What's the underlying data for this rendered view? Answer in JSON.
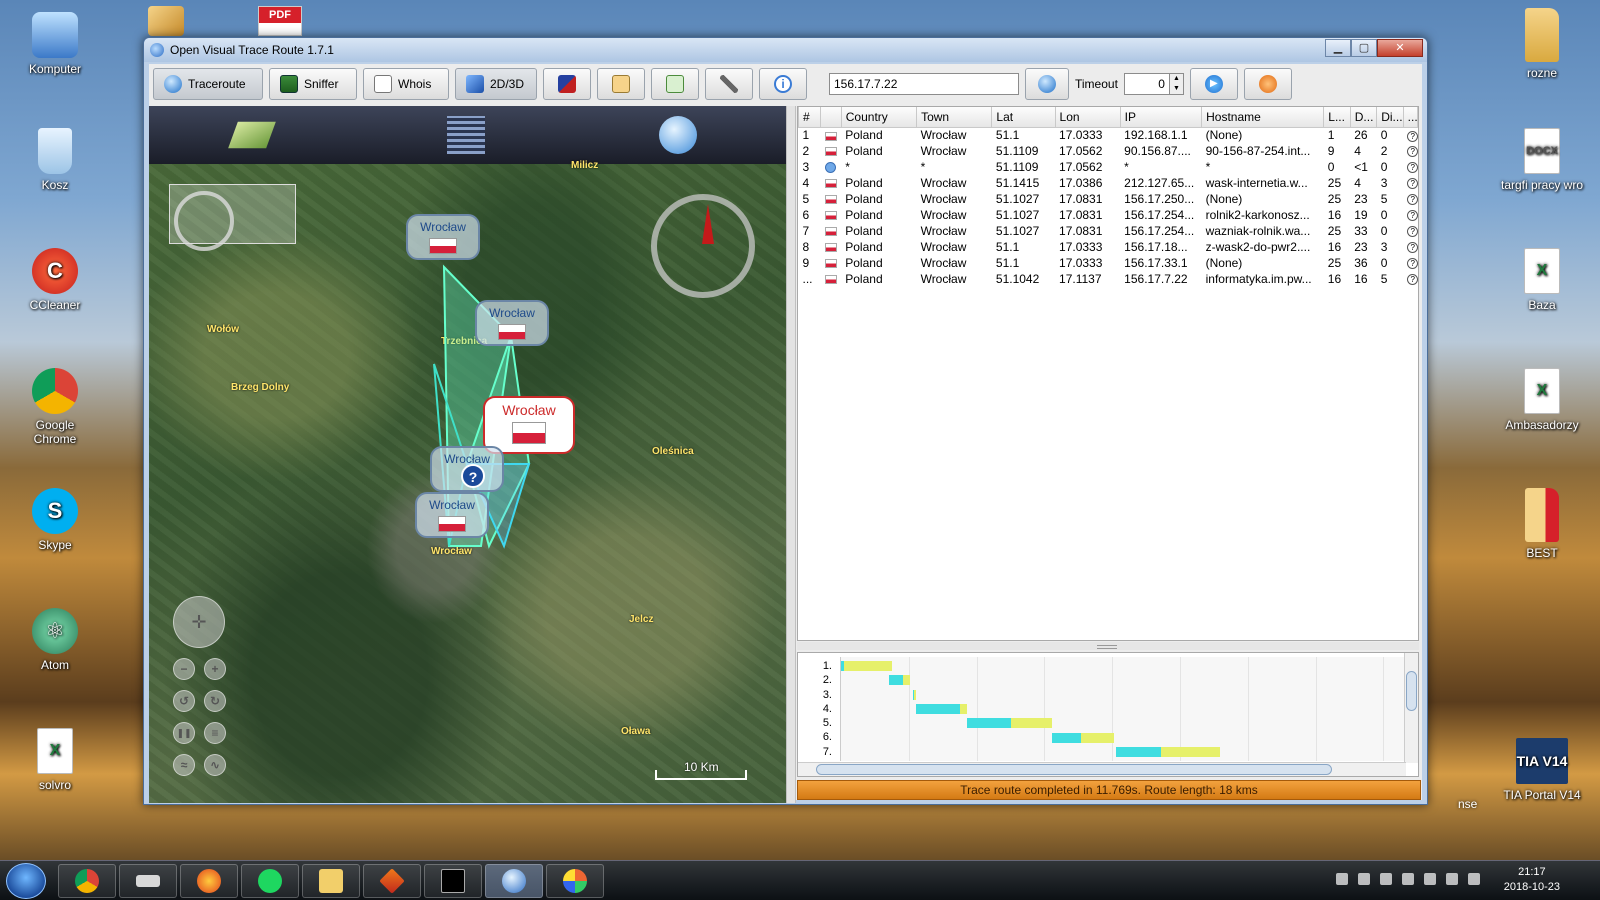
{
  "desktop": {
    "left_icons": [
      {
        "label": "Komputer",
        "icon": "computer-icon"
      },
      {
        "label": "Kosz",
        "icon": "recycle-bin-icon"
      },
      {
        "label": "CCleaner",
        "icon": "ccleaner-icon"
      },
      {
        "label": "Google Chrome",
        "icon": "chrome-icon"
      },
      {
        "label": "Skype",
        "icon": "skype-icon"
      },
      {
        "label": "Atom",
        "icon": "atom-icon"
      },
      {
        "label": "solvro",
        "icon": "excel-file-icon"
      }
    ],
    "right_icons": [
      {
        "label": "rozne",
        "icon": "folder-icon"
      },
      {
        "label": "targfi pracy wro",
        "icon": "docx-file-icon",
        "badge": "DOCX"
      },
      {
        "label": "Baza",
        "icon": "excel-file-icon"
      },
      {
        "label": "Ambasadorzy",
        "icon": "excel-file-icon"
      },
      {
        "label": "BEST",
        "icon": "pdf-folder-icon"
      },
      {
        "label": "TIA Portal V14",
        "icon": "tia-portal-icon",
        "badge": "TIA V14"
      }
    ],
    "partial_label": "nse",
    "pdf_badge": "PDF"
  },
  "window": {
    "title": "Open Visual Trace Route 1.7.1",
    "buttons": {
      "minimize": "▁",
      "maximize": "▢",
      "close": "✕"
    }
  },
  "toolbar": {
    "traceroute": "Traceroute",
    "sniffer": "Sniffer",
    "whois": "Whois",
    "view": "2D/3D",
    "target_ip": "156.17.7.22",
    "timeout_label": "Timeout",
    "timeout_value": "0",
    "info_glyph": "i"
  },
  "map": {
    "places": [
      "Milicz",
      "Wołów",
      "Trzebnica",
      "Brzeg Dolny",
      "Oleśnica",
      "Wrocław",
      "Jelcz",
      "Oława"
    ],
    "hops": [
      {
        "label": "Wrocław"
      },
      {
        "label": "Wrocław"
      },
      {
        "label": "Wrocław"
      },
      {
        "label": "Wrocław"
      },
      {
        "label": "Wrocław"
      }
    ],
    "unknown_glyph": "?",
    "scale": "10 Km",
    "accent": "#66ffcc"
  },
  "table": {
    "columns": [
      "#",
      "",
      "Country",
      "Town",
      "Lat",
      "Lon",
      "IP",
      "Hostname",
      "L...",
      "D...",
      "Di...",
      "..."
    ],
    "rows": [
      {
        "n": "1",
        "country": "Poland",
        "town": "Wrocław",
        "lat": "51.1",
        "lon": "17.0333",
        "ip": "192.168.1.1",
        "host": "(None)",
        "l": "1",
        "d": "26",
        "di": "0"
      },
      {
        "n": "2",
        "country": "Poland",
        "town": "Wrocław",
        "lat": "51.1109",
        "lon": "17.0562",
        "ip": "90.156.87....",
        "host": "90-156-87-254.int...",
        "l": "9",
        "d": "4",
        "di": "2"
      },
      {
        "n": "3",
        "country": "*",
        "town": "*",
        "lat": "51.1109",
        "lon": "17.0562",
        "ip": "*",
        "host": "*",
        "l": "0",
        "d": "<1",
        "di": "0",
        "unknown": true
      },
      {
        "n": "4",
        "country": "Poland",
        "town": "Wrocław",
        "lat": "51.1415",
        "lon": "17.0386",
        "ip": "212.127.65...",
        "host": "wask-internetia.w...",
        "l": "25",
        "d": "4",
        "di": "3"
      },
      {
        "n": "5",
        "country": "Poland",
        "town": "Wrocław",
        "lat": "51.1027",
        "lon": "17.0831",
        "ip": "156.17.250...",
        "host": "(None)",
        "l": "25",
        "d": "23",
        "di": "5"
      },
      {
        "n": "6",
        "country": "Poland",
        "town": "Wrocław",
        "lat": "51.1027",
        "lon": "17.0831",
        "ip": "156.17.254...",
        "host": "rolnik2-karkonosz...",
        "l": "16",
        "d": "19",
        "di": "0"
      },
      {
        "n": "7",
        "country": "Poland",
        "town": "Wrocław",
        "lat": "51.1027",
        "lon": "17.0831",
        "ip": "156.17.254...",
        "host": "wazniak-rolnik.wa...",
        "l": "25",
        "d": "33",
        "di": "0"
      },
      {
        "n": "8",
        "country": "Poland",
        "town": "Wrocław",
        "lat": "51.1",
        "lon": "17.0333",
        "ip": "156.17.18...",
        "host": "z-wask2-do-pwr2....",
        "l": "16",
        "d": "23",
        "di": "3"
      },
      {
        "n": "9",
        "country": "Poland",
        "town": "Wrocław",
        "lat": "51.1",
        "lon": "17.0333",
        "ip": "156.17.33.1",
        "host": "(None)",
        "l": "25",
        "d": "36",
        "di": "0"
      },
      {
        "n": "...",
        "country": "Poland",
        "town": "Wrocław",
        "lat": "51.1042",
        "lon": "17.1137",
        "ip": "156.17.7.22",
        "host": "informatyka.im.pw...",
        "l": "16",
        "d": "16",
        "di": "5"
      }
    ],
    "help_glyph": "?"
  },
  "gantt": {
    "labels": [
      "1.",
      "2.",
      "3.",
      "4.",
      "5.",
      "6.",
      "7."
    ],
    "bars": [
      {
        "start": 0.0,
        "cyan": 0.005,
        "yellow": 0.085
      },
      {
        "start": 0.085,
        "cyan": 0.025,
        "yellow": 0.012
      },
      {
        "start": 0.128,
        "cyan": 0.002,
        "yellow": 0.002
      },
      {
        "start": 0.132,
        "cyan": 0.078,
        "yellow": 0.013
      },
      {
        "start": 0.223,
        "cyan": 0.078,
        "yellow": 0.073
      },
      {
        "start": 0.374,
        "cyan": 0.05,
        "yellow": 0.06
      },
      {
        "start": 0.486,
        "cyan": 0.08,
        "yellow": 0.105
      }
    ],
    "colors": {
      "cyan": "#3fdde0",
      "yellow": "#e6f06a"
    }
  },
  "status": "Trace route completed in 11.769s. Route length: 18 kms",
  "taskbar": {
    "time": "21:17",
    "date": "2018-10-23",
    "apps": [
      "chrome-icon",
      "scanner-icon",
      "firefox-icon",
      "spotify-icon",
      "explorer-icon",
      "matlab-icon",
      "cmd-icon",
      "ovtr-icon",
      "paint-icon"
    ]
  }
}
